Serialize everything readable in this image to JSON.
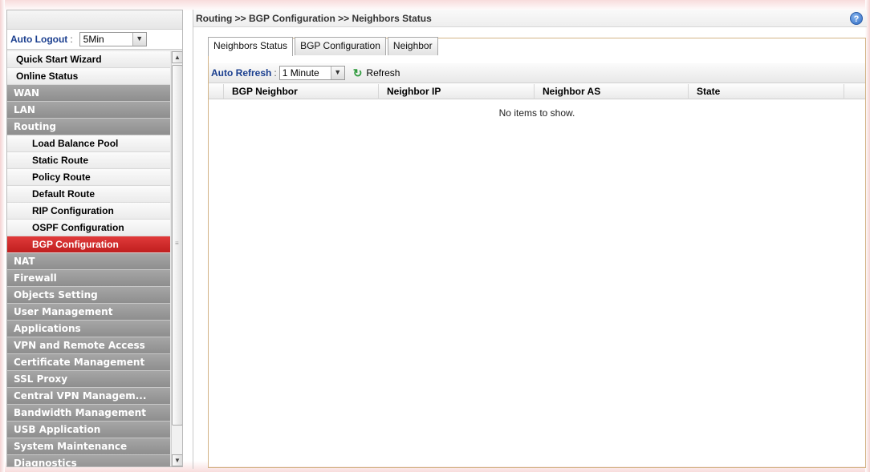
{
  "sidebar": {
    "auto_logout_label": "Auto Logout",
    "auto_logout_colon": ":",
    "auto_logout_value": "5Min",
    "items": [
      {
        "label": "Quick Start Wizard",
        "kind": "light"
      },
      {
        "label": "Online Status",
        "kind": "light"
      },
      {
        "label": "WAN",
        "kind": "section"
      },
      {
        "label": "LAN",
        "kind": "section"
      },
      {
        "label": "Routing",
        "kind": "section"
      },
      {
        "label": "Load Balance Pool",
        "kind": "sub"
      },
      {
        "label": "Static Route",
        "kind": "sub"
      },
      {
        "label": "Policy Route",
        "kind": "sub"
      },
      {
        "label": "Default Route",
        "kind": "sub"
      },
      {
        "label": "RIP Configuration",
        "kind": "sub"
      },
      {
        "label": "OSPF Configuration",
        "kind": "sub"
      },
      {
        "label": "BGP Configuration",
        "kind": "active"
      },
      {
        "label": "NAT",
        "kind": "section"
      },
      {
        "label": "Firewall",
        "kind": "section"
      },
      {
        "label": "Objects Setting",
        "kind": "section"
      },
      {
        "label": "User Management",
        "kind": "section"
      },
      {
        "label": "Applications",
        "kind": "section"
      },
      {
        "label": "VPN and Remote Access",
        "kind": "section"
      },
      {
        "label": "Certificate Management",
        "kind": "section"
      },
      {
        "label": "SSL Proxy",
        "kind": "section"
      },
      {
        "label": "Central VPN Managem...",
        "kind": "section"
      },
      {
        "label": "Bandwidth Management",
        "kind": "section"
      },
      {
        "label": "USB Application",
        "kind": "section"
      },
      {
        "label": "System Maintenance",
        "kind": "section"
      },
      {
        "label": "Diagnostics",
        "kind": "section"
      }
    ],
    "scroll_up_glyph": "▲",
    "scroll_down_glyph": "▼"
  },
  "header": {
    "breadcrumb": "Routing >> BGP Configuration >> Neighbors Status",
    "help_glyph": "?"
  },
  "tabs": [
    {
      "label": "Neighbors Status",
      "active": true
    },
    {
      "label": "BGP Configuration",
      "active": false
    },
    {
      "label": "Neighbor",
      "active": false
    }
  ],
  "toolbar": {
    "auto_refresh_label": "Auto Refresh",
    "auto_refresh_colon": ":",
    "auto_refresh_value": "1 Minute",
    "refresh_label": "Refresh"
  },
  "table": {
    "columns": [
      "BGP Neighbor",
      "Neighbor IP",
      "Neighbor AS",
      "State"
    ],
    "empty_message": "No items to show."
  },
  "colors": {
    "accent_blue": "#1b3f8f",
    "active_menu_red": "#c01f1f",
    "section_gray": "#8e8e8e",
    "refresh_green": "#2e9a3c",
    "panel_border": "#d3b487"
  },
  "icons": {
    "help": "help-icon",
    "refresh": "refresh-icon",
    "dropdown": "chevron-down-icon"
  }
}
